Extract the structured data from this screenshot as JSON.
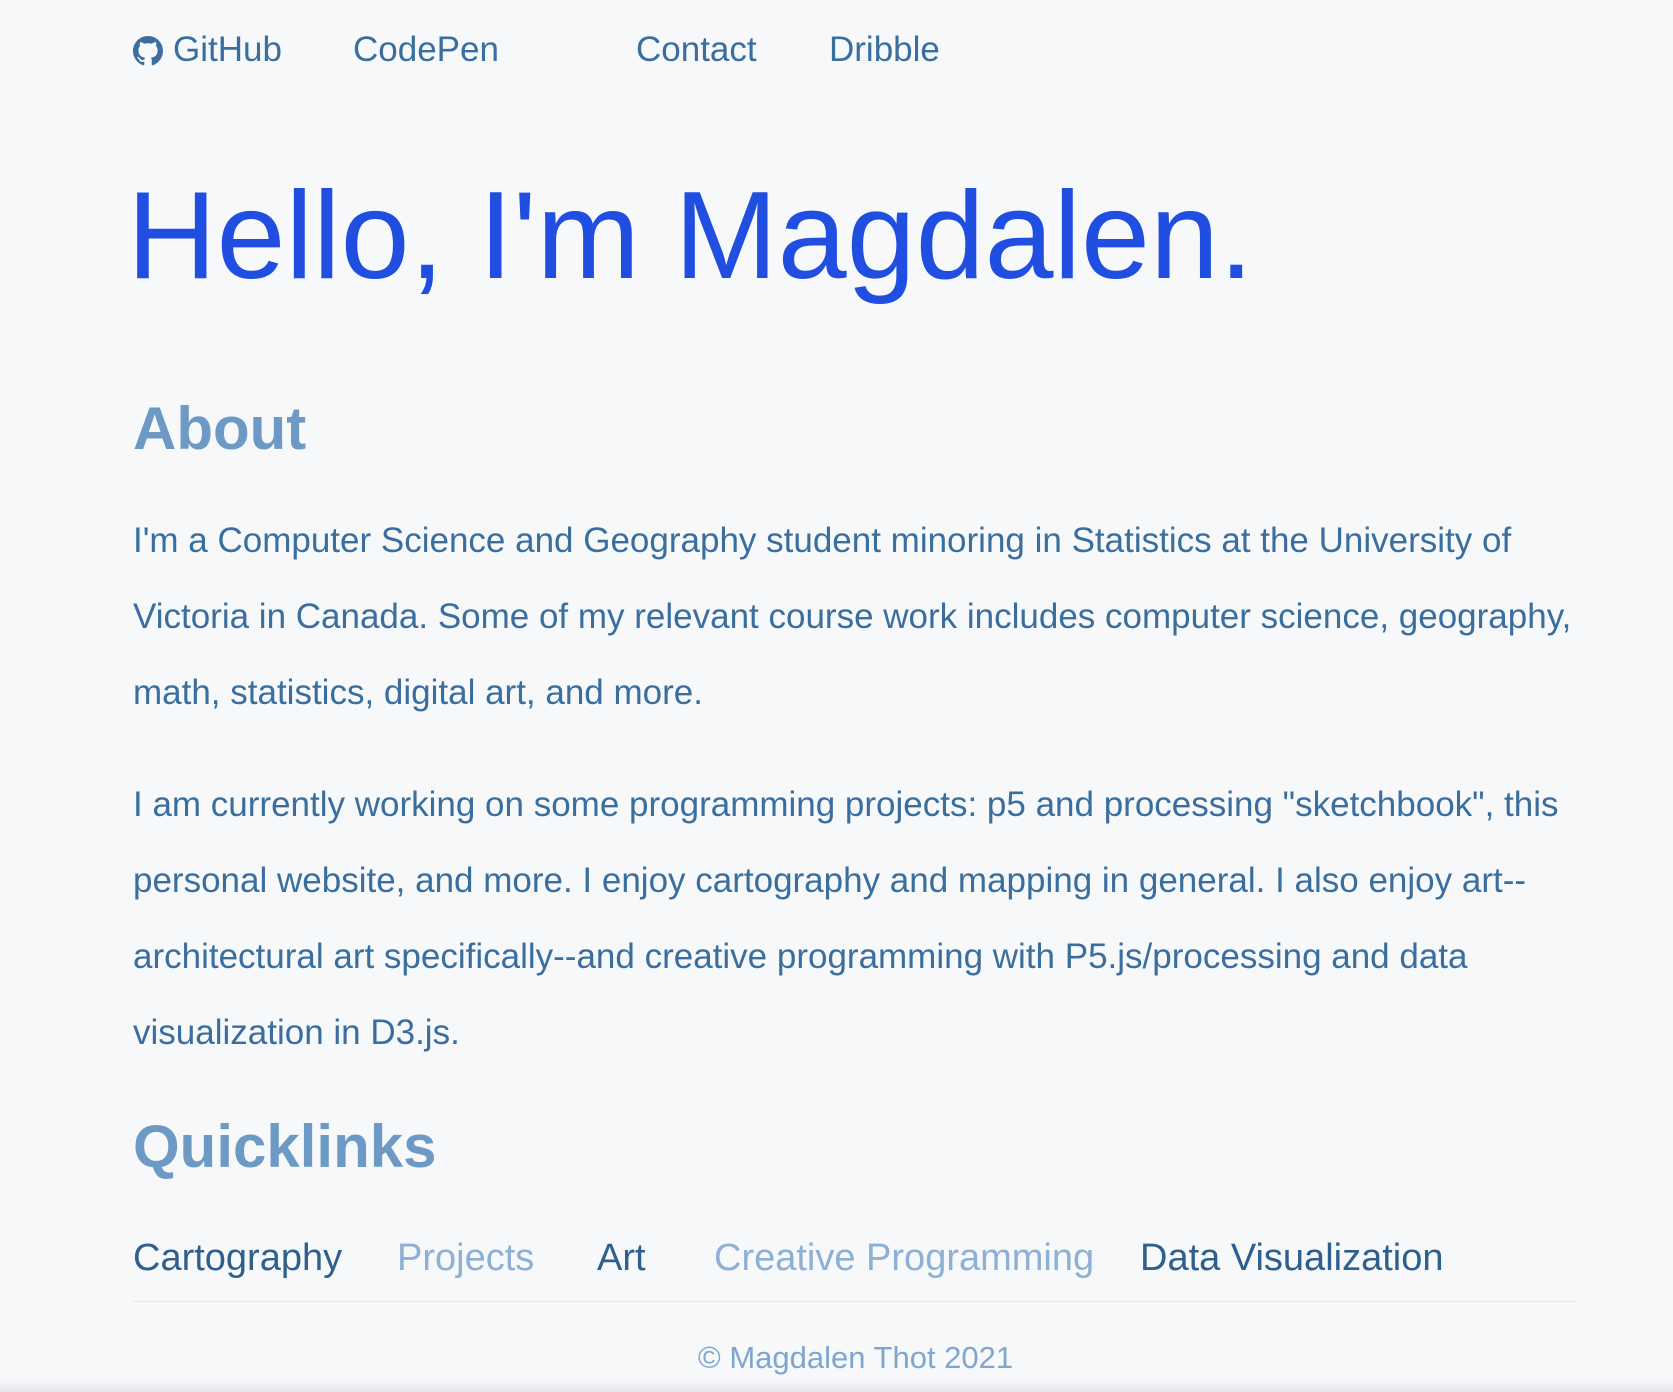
{
  "nav": {
    "github_label": "GitHub",
    "codepen_label": "CodePen",
    "contact_label": "Contact",
    "dribble_label": "Dribble",
    "github_icon": "github-icon"
  },
  "hero": {
    "title": "Hello, I'm Magdalen."
  },
  "about": {
    "heading": "About",
    "paragraph1": "I'm a Computer Science and Geography student minoring in Statistics at the University of Victoria in Canada. Some of my relevant course work includes computer science, geography, math, statistics, digital art, and more.",
    "paragraph2": "I am currently working on some programming projects: p5 and processing \"sketchbook\", this personal website, and more. I enjoy cartography and mapping in general. I also enjoy art--architectural art specifically--and creative programming with P5.js/processing and data visualization in D3.js."
  },
  "quicklinks": {
    "heading": "Quicklinks",
    "items": [
      {
        "label": "Cartography"
      },
      {
        "label": "Projects"
      },
      {
        "label": "Art"
      },
      {
        "label": "Creative Programming"
      },
      {
        "label": "Data Visualization"
      }
    ]
  },
  "footer": {
    "text": "© Magdalen Thot 2021"
  },
  "colors": {
    "background": "#f7f8fa",
    "hero": "#1f4ee0",
    "link": "#3a6e9f",
    "heading": "#6c9ac4",
    "link_light": "#8db0d4",
    "link_dark": "#2f5f8d"
  }
}
